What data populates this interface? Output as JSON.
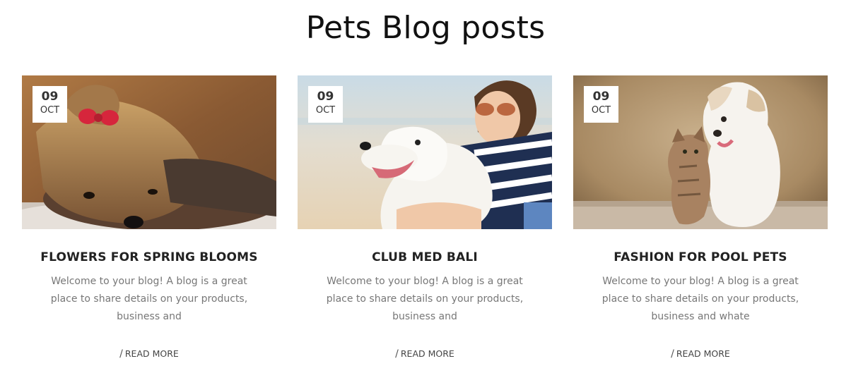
{
  "section": {
    "title": "Pets Blog posts"
  },
  "posts": [
    {
      "day": "09",
      "month": "OCT",
      "title": "FLOWERS FOR SPRING BLOOMS",
      "excerpt": "Welcome to your blog! A blog is a great place to share details on your products, business and",
      "read_more": "READ MORE",
      "image": "yorkshire-terrier-with-red-bow"
    },
    {
      "day": "09",
      "month": "OCT",
      "title": "CLUB MED BALI",
      "excerpt": "Welcome to your blog! A blog is a great place to share details on your products, business and",
      "read_more": "READ MORE",
      "image": "woman-hugging-white-dog-on-beach"
    },
    {
      "day": "09",
      "month": "OCT",
      "title": "FASHION FOR POOL PETS",
      "excerpt": "Welcome to your blog! A blog is a great place to share details on your products, business and whate",
      "read_more": "READ MORE",
      "image": "white-puppy-and-tabby-kitten"
    }
  ],
  "read_more_separator": "/"
}
